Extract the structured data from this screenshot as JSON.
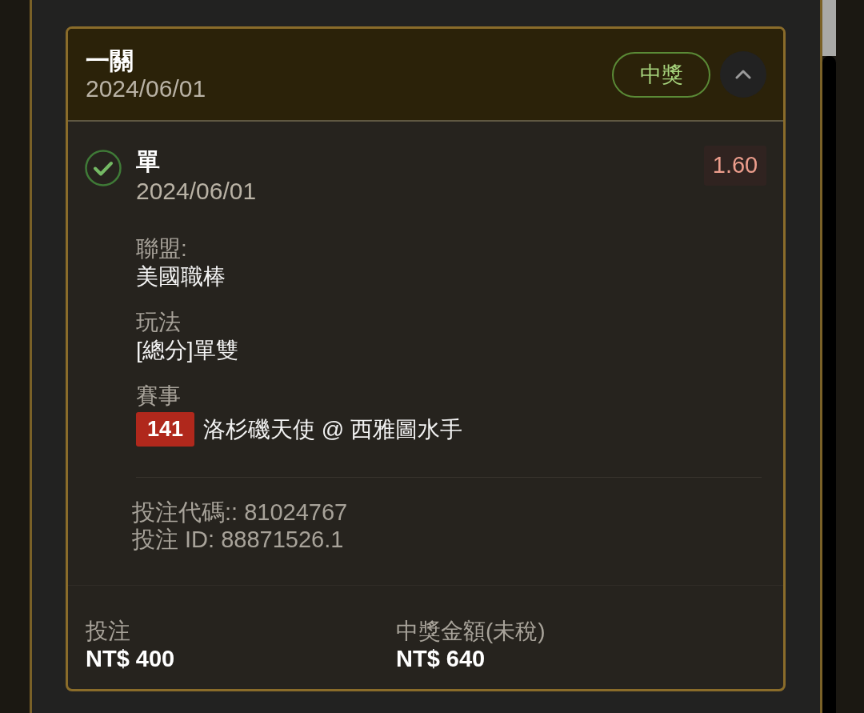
{
  "bet": {
    "title": "一關",
    "date": "2024/06/01",
    "status": "中獎",
    "expanded": true,
    "selections": [
      {
        "won": true,
        "name": "單",
        "date": "2024/06/01",
        "odds": "1.60",
        "details": [
          {
            "kind": "text",
            "label": "聯盟:",
            "value": "美國職棒"
          },
          {
            "kind": "text",
            "label": "玩法",
            "value": "[總分]單雙"
          },
          {
            "kind": "event",
            "label": "賽事",
            "number": "141",
            "value": "洛杉磯天使 @ 西雅圖水手"
          }
        ],
        "codes": [
          "投注代碼:: 81024767",
          "投注 ID: 88871526.1"
        ]
      }
    ],
    "summary": [
      {
        "label": "投注",
        "value": "NT$ 400"
      },
      {
        "label": "中獎金額(未稅)",
        "value": "NT$ 640"
      }
    ]
  }
}
